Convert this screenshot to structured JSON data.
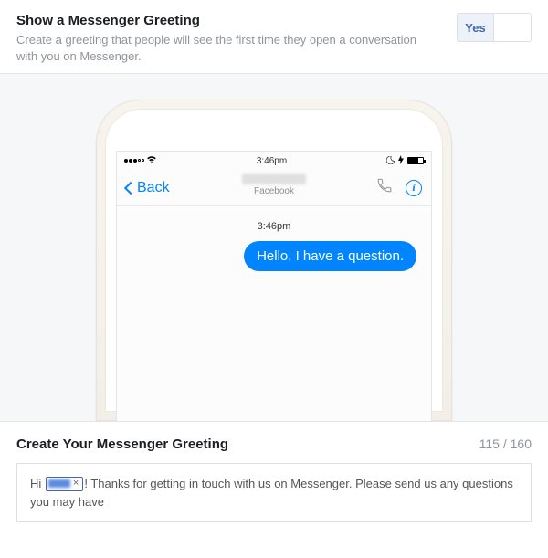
{
  "header": {
    "title": "Show a Messenger Greeting",
    "description": "Create a greeting that people will see the first time they open a conversation with you on Messenger.",
    "toggle": {
      "yes": "Yes",
      "no": ""
    }
  },
  "phone": {
    "status_time": "3:46pm",
    "nav": {
      "back": "Back",
      "subtitle": "Facebook",
      "info_glyph": "i"
    },
    "chat": {
      "timestamp": "3:46pm",
      "bubble": "Hello, I have a question."
    }
  },
  "editor": {
    "title": "Create Your Messenger Greeting",
    "count": "115 / 160",
    "prefix": "Hi ",
    "token_close": "×",
    "suffix": "! Thanks for getting in touch with us on Messenger. Please send us any questions you may have"
  }
}
